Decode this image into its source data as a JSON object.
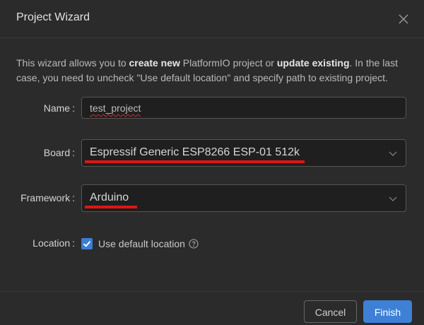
{
  "dialog": {
    "title": "Project Wizard",
    "close_icon": "close-icon"
  },
  "description": {
    "part1": "This wizard allows you to ",
    "bold1": "create new",
    "part2": " PlatformIO project or ",
    "bold2": "update existing",
    "part3": ". In the last case, you need to uncheck \"Use default location\" and specify path to existing project."
  },
  "form": {
    "name": {
      "label": "Name",
      "value": "test_project"
    },
    "board": {
      "label": "Board",
      "value": "Espressif Generic ESP8266 ESP-01 512k"
    },
    "framework": {
      "label": "Framework",
      "value": "Arduino"
    },
    "location": {
      "label": "Location",
      "checkbox_label": "Use default location",
      "checked": true
    }
  },
  "footer": {
    "cancel_label": "Cancel",
    "finish_label": "Finish"
  },
  "colors": {
    "accent": "#3d80d6",
    "highlight_mark": "#e01515"
  }
}
